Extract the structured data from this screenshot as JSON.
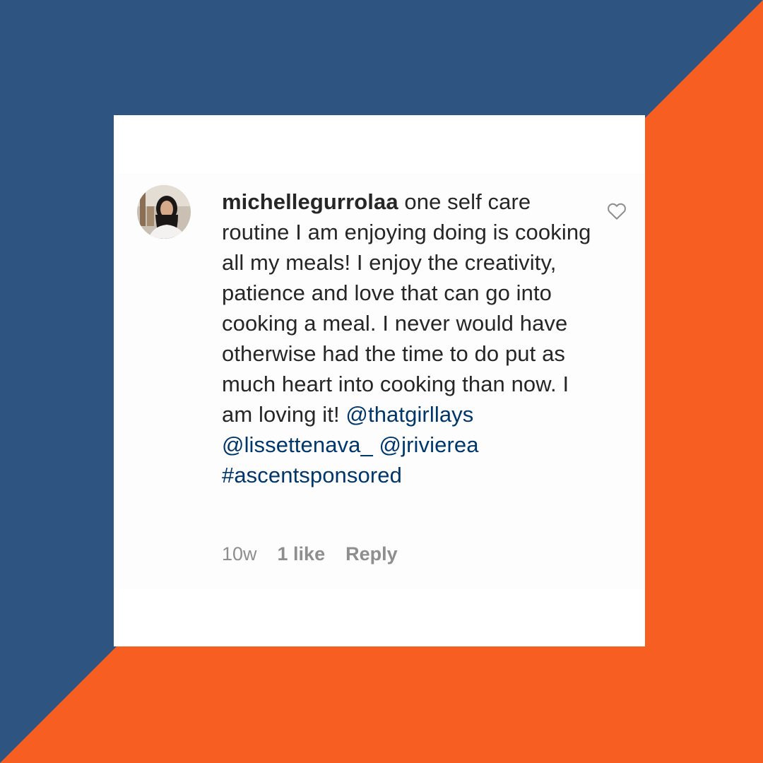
{
  "colors": {
    "background_blue": "#2e5481",
    "background_orange": "#f75e21",
    "card": "#ffffff",
    "text": "#262626",
    "link": "#00376b",
    "muted": "#8e8e8e"
  },
  "comment": {
    "username": "michellegurrolaa",
    "text": "one self care routine I am enjoying doing is cooking all my meals! I enjoy the creativity, patience and love that can go into cooking a meal. I never would have otherwise had the time to do put as much heart into cooking than now. I am loving it!",
    "mentions": [
      "@thatgirllays",
      "@lissettenava_",
      "@jrivierea"
    ],
    "hashtag": "#ascentsponsored",
    "timestamp": "10w",
    "likes": "1 like",
    "reply_label": "Reply",
    "like_icon": "heart-outline-icon",
    "avatar_icon": "user-photo"
  }
}
